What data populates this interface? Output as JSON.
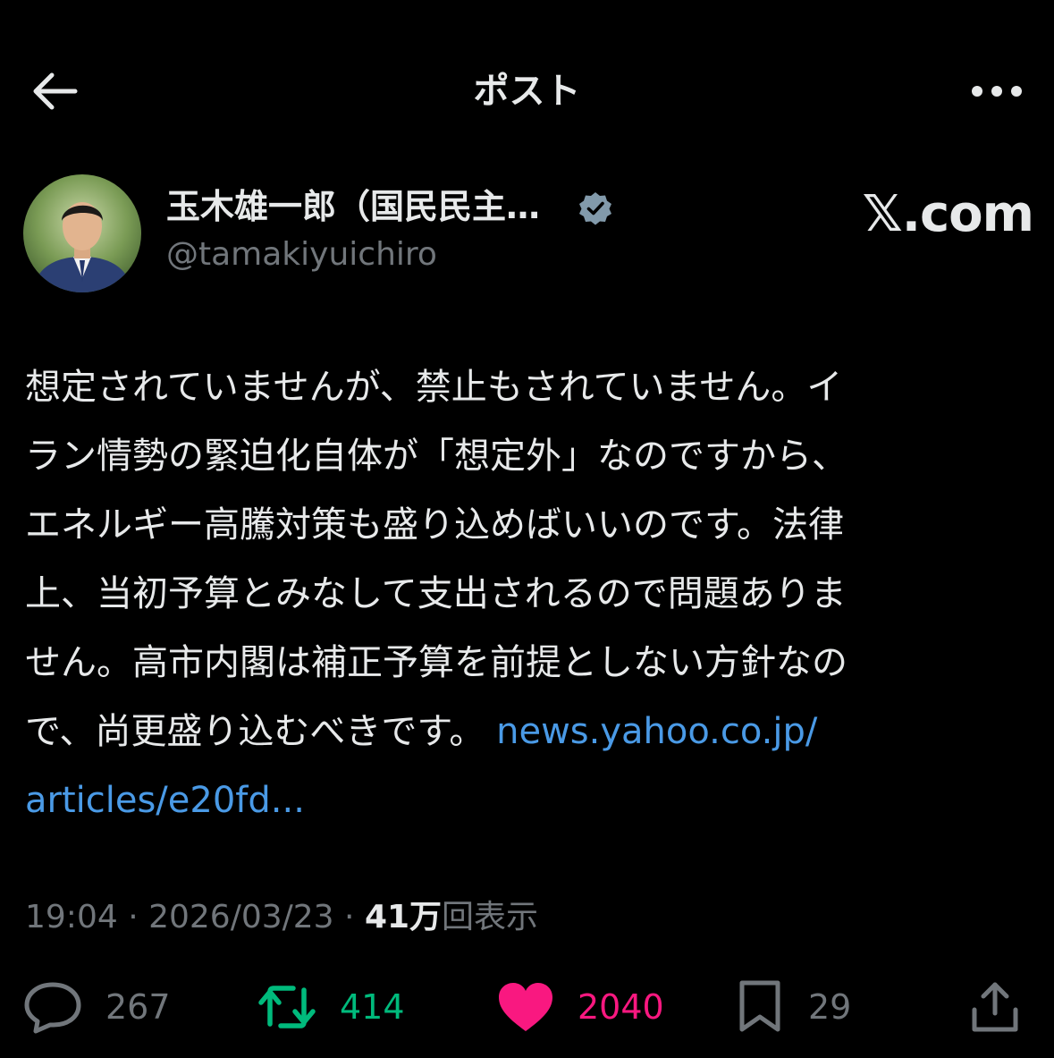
{
  "header": {
    "title": "ポスト",
    "back_icon": "arrow-left-icon",
    "more_icon": "more-horizontal-icon"
  },
  "author": {
    "display_name": "玉木雄一郎（国民民主…",
    "handle": "@tamakiyuichiro",
    "verified": true,
    "site_logo": "𝕏.com"
  },
  "post": {
    "lines": [
      "想定されていませんが、禁止もされていません。イ",
      "ラン情勢の緊迫化自体が「想定外」なのですから、",
      "エネルギー高騰対策も盛り込めばいいのです。法律",
      "上、当初予算とみなして支出されるので問題ありま",
      "せん。高市内閣は補正予算を前提としない方針なの"
    ],
    "last_line_text": "で、尚更盛り込むべきです。 ",
    "link_part1": "news.yahoo.co.jp/",
    "link_part2": "articles/e20fd..."
  },
  "meta": {
    "time": "19:04",
    "date": "2026/03/23",
    "views_count": "41万",
    "views_label": "回表示"
  },
  "actions": {
    "replies": "267",
    "reposts": "414",
    "likes": "2040",
    "bookmarks": "29"
  },
  "colors": {
    "background": "#000000",
    "text": "#e7e9ea",
    "muted": "#71767b",
    "link": "#4a9ae6",
    "repost": "#00ba7c",
    "like": "#f91880",
    "verified": "#829aab"
  }
}
